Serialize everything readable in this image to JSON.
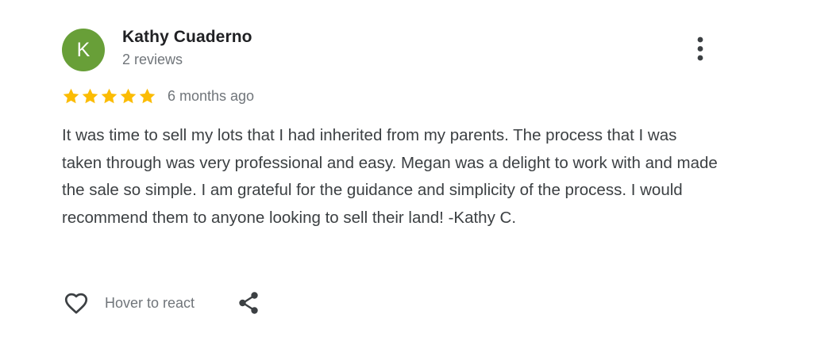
{
  "reviewer": {
    "initial": "K",
    "name": "Kathy Cuaderno",
    "review_count": "2 reviews",
    "avatar_color": "#689f38"
  },
  "rating": {
    "stars": 5,
    "max_stars": 5,
    "star_color": "#fbbc04",
    "date": "6 months ago"
  },
  "review": {
    "text": "It was time to sell my lots that I had inherited from my parents. The process that I was taken through was very professional and easy. Megan was a delight to work with and made the sale so simple. I am grateful for the guidance and simplicity of the process. I would recommend them to anyone looking to sell their land! -Kathy C."
  },
  "actions": {
    "react_label": "Hover to react",
    "like_icon": "heart-outline-icon",
    "share_icon": "share-icon",
    "more_icon": "more-vert-icon"
  }
}
